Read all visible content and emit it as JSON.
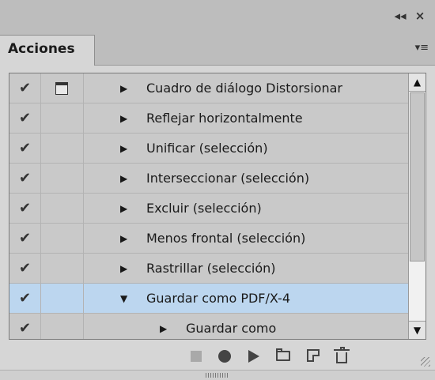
{
  "titlebar": {
    "collapse_icon": "double-chevron-left-icon",
    "close_icon": "close-icon",
    "collapse_glyph": "◂◂",
    "close_glyph": "×"
  },
  "tabs": [
    {
      "label": "Acciones",
      "active": true
    }
  ],
  "panel_menu": {
    "icon": "panel-menu-icon",
    "glyph": "▾≡"
  },
  "actions": [
    {
      "label": "Cuadro de diálogo Distorsionar",
      "checked": true,
      "dialog": true,
      "expanded": false,
      "indent": 0,
      "selected": false
    },
    {
      "label": "Reflejar horizontalmente",
      "checked": true,
      "dialog": false,
      "expanded": false,
      "indent": 0,
      "selected": false
    },
    {
      "label": "Unificar (selección)",
      "checked": true,
      "dialog": false,
      "expanded": false,
      "indent": 0,
      "selected": false
    },
    {
      "label": "Interseccionar (selección)",
      "checked": true,
      "dialog": false,
      "expanded": false,
      "indent": 0,
      "selected": false
    },
    {
      "label": "Excluir (selección)",
      "checked": true,
      "dialog": false,
      "expanded": false,
      "indent": 0,
      "selected": false
    },
    {
      "label": "Menos frontal (selección)",
      "checked": true,
      "dialog": false,
      "expanded": false,
      "indent": 0,
      "selected": false
    },
    {
      "label": "Rastrillar (selección)",
      "checked": true,
      "dialog": false,
      "expanded": false,
      "indent": 0,
      "selected": false
    },
    {
      "label": "Guardar como PDF/X-4",
      "checked": true,
      "dialog": false,
      "expanded": true,
      "indent": 0,
      "selected": true
    },
    {
      "label": "Guardar como",
      "checked": true,
      "dialog": false,
      "expanded": false,
      "indent": 1,
      "selected": false
    }
  ],
  "glyphs": {
    "check": "✔",
    "collapsed": "▶",
    "expanded": "▼",
    "scroll_up": "▲",
    "scroll_down": "▼"
  },
  "colors": {
    "selected_row": "#bcd6ef",
    "panel_bg": "#d6d6d6"
  },
  "toolbar": [
    {
      "name": "stop-button",
      "icon": "stop-icon",
      "enabled": false
    },
    {
      "name": "record-button",
      "icon": "record-icon",
      "enabled": true
    },
    {
      "name": "play-button",
      "icon": "play-icon",
      "enabled": true
    },
    {
      "name": "new-set-button",
      "icon": "folder-icon",
      "enabled": true
    },
    {
      "name": "new-action-button",
      "icon": "new-page-icon",
      "enabled": true
    },
    {
      "name": "delete-button",
      "icon": "trash-icon",
      "enabled": true
    }
  ]
}
